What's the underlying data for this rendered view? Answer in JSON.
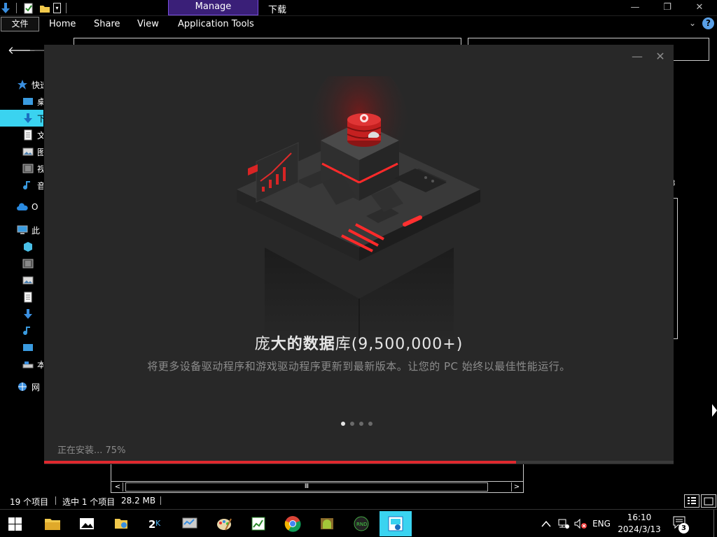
{
  "titlebar": {
    "context_tab": "Manage",
    "window_title": "下载",
    "minimize_icon": "minimize-icon",
    "restore_icon": "restore-icon",
    "close_icon": "close-icon"
  },
  "ribbon": {
    "file_tab": "文件",
    "tabs": [
      "Home",
      "Share",
      "View",
      "Application Tools"
    ]
  },
  "sidebar": {
    "items": [
      {
        "label": "快速",
        "icon": "star-icon"
      },
      {
        "label": "桌",
        "icon": "desktop-icon"
      },
      {
        "label": "下",
        "icon": "download-icon",
        "selected": true
      },
      {
        "label": "文",
        "icon": "document-icon"
      },
      {
        "label": "图",
        "icon": "pictures-icon"
      },
      {
        "label": "视",
        "icon": "video-icon"
      },
      {
        "label": "音",
        "icon": "music-icon"
      },
      {
        "label": "O",
        "icon": "onedrive-icon"
      },
      {
        "label": "此",
        "icon": "this-pc-icon"
      },
      {
        "label": "",
        "icon": "3d-objects-icon"
      },
      {
        "label": "",
        "icon": "video-icon"
      },
      {
        "label": "",
        "icon": "pictures-icon"
      },
      {
        "label": "",
        "icon": "document-icon"
      },
      {
        "label": "",
        "icon": "download-icon"
      },
      {
        "label": "",
        "icon": "music-icon"
      },
      {
        "label": "",
        "icon": "desktop-icon"
      },
      {
        "label": "本",
        "icon": "local-disk-icon"
      },
      {
        "label": "网",
        "icon": "network-icon"
      }
    ]
  },
  "main": {
    "partial_number": "3"
  },
  "dialog": {
    "headline_light_1": "庞",
    "headline_bold": "大的数据",
    "headline_light_2": "库(9,500,000+)",
    "subline": "将更多设备驱动程序和游戏驱动程序更新到最新版本。让您的 PC 始终以最佳性能运行。",
    "install_status": "正在安装... 75%",
    "progress": 0.75,
    "pager": {
      "count": 4,
      "active_index": 0
    },
    "accent_color": "#e0282e"
  },
  "statusbar": {
    "item_count": "19 个项目",
    "selection": "选中 1 个项目",
    "size": "28.2 MB"
  },
  "taskbar": {
    "apps": [
      {
        "name": "file-explorer-icon"
      },
      {
        "name": "photos-icon"
      },
      {
        "name": "folder-user-icon"
      },
      {
        "name": "2k-game-icon"
      },
      {
        "name": "network-tool-icon"
      },
      {
        "name": "paint-icon"
      },
      {
        "name": "spreadsheet-icon"
      },
      {
        "name": "chrome-icon"
      },
      {
        "name": "android-icon"
      },
      {
        "name": "gpu-tool-icon"
      },
      {
        "name": "driver-installer-icon",
        "active": true
      }
    ],
    "language": "ENG",
    "time": "16:10",
    "date": "2024/3/13",
    "notification_count": "3"
  }
}
